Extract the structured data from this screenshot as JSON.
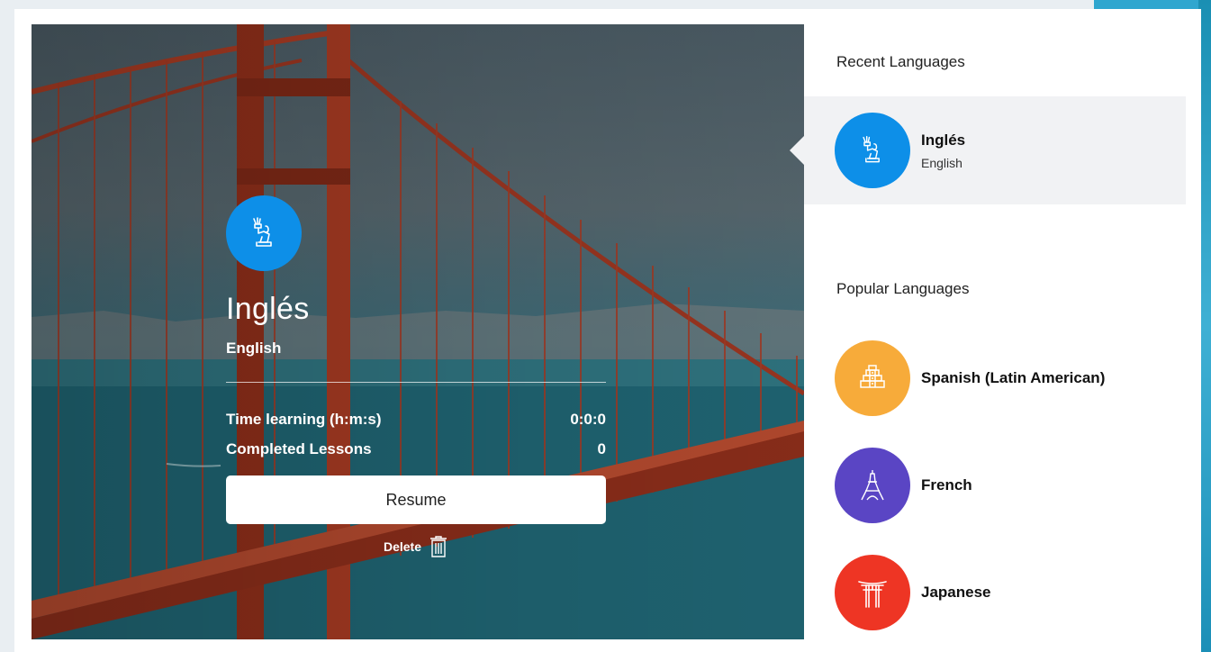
{
  "hero": {
    "title": "Inglés",
    "subtitle": "English",
    "stats": [
      {
        "label": "Time learning (h:m:s)",
        "value": "0:0:0"
      },
      {
        "label": "Completed Lessons",
        "value": "0"
      }
    ],
    "resume_label": "Resume",
    "delete_label": "Delete"
  },
  "recent": {
    "title": "Recent Languages",
    "items": [
      {
        "name": "Inglés",
        "sub": "English",
        "icon": "statue-of-liberty-icon",
        "color": "#0d8fe8"
      }
    ]
  },
  "popular": {
    "title": "Popular Languages",
    "items": [
      {
        "name": "Spanish (Latin American)",
        "icon": "pyramid-icon",
        "color": "#f7ab3a"
      },
      {
        "name": "French",
        "icon": "eiffel-tower-icon",
        "color": "#5a45c4"
      },
      {
        "name": "Japanese",
        "icon": "torii-gate-icon",
        "color": "#ee3524"
      }
    ]
  }
}
